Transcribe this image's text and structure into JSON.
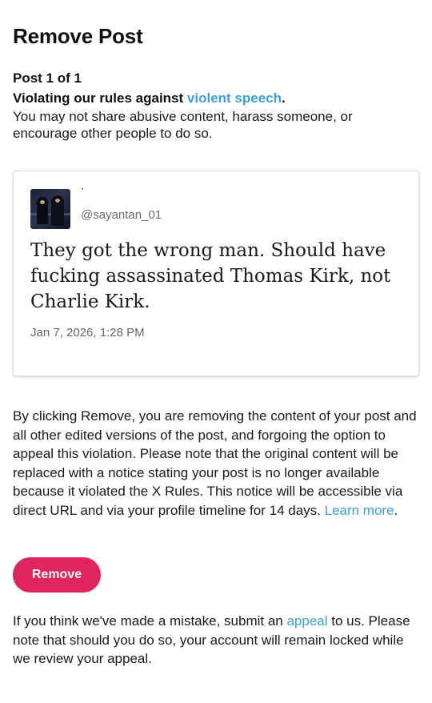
{
  "header": {
    "title": "Remove Post",
    "counter": "Post 1 of 1"
  },
  "violation": {
    "prefix": "Violating our rules against ",
    "rule_link": "violent speech",
    "suffix": ".",
    "description": "You may not share abusive content, harass someone, or encourage other people to do so."
  },
  "post": {
    "display_name": "ˋ",
    "handle": "@sayantan_01",
    "text": "They got the wrong man. Should have fucking assassinated Thomas Kirk, not Charlie Kirk.",
    "timestamp": "Jan 7, 2026, 1:28 PM"
  },
  "notice": {
    "body": "By clicking Remove, you are removing the content of your post and all other edited versions of the post, and forgoing the option to appeal this violation. Please note that the original content will be replaced with a notice stating your post is no longer available because it violated the X Rules. This notice will be accessible via direct URL and via your profile timeline for 14 days. ",
    "learn_more": "Learn more",
    "end": "."
  },
  "actions": {
    "remove_label": "Remove"
  },
  "appeal": {
    "prefix": "If you think we've made a mistake, submit an ",
    "link": "appeal",
    "suffix": " to us. Please note that should you do so, your account will remain locked while we review your appeal."
  },
  "colors": {
    "link": "#3aa0d9",
    "remove_button": "#e0245e"
  }
}
